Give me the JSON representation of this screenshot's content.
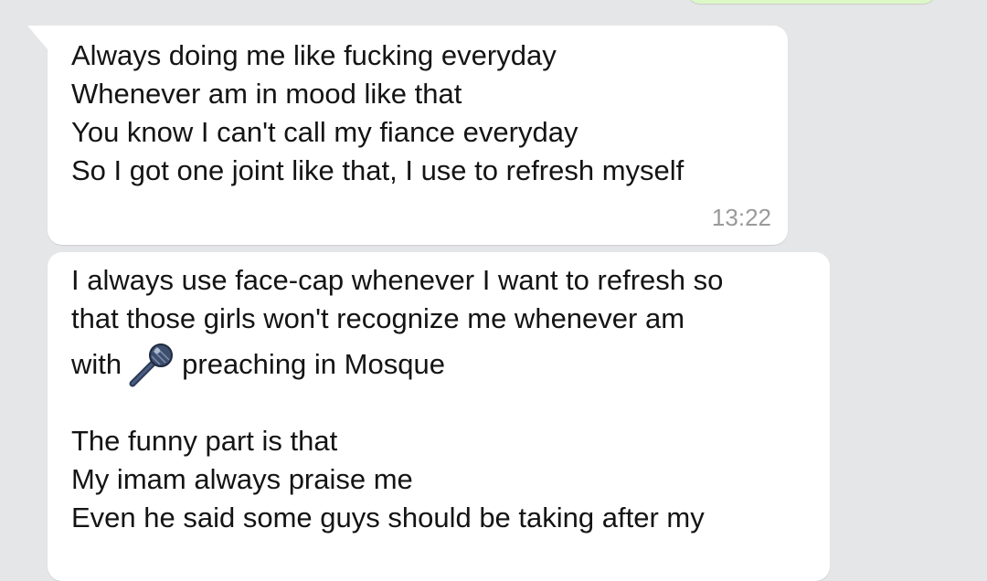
{
  "colors": {
    "background": "#e5e6e8",
    "incoming_bubble": "#ffffff",
    "outgoing_bubble": "#dcf8c6",
    "timestamp": "#9a9a9a",
    "text": "#141414"
  },
  "messages": [
    {
      "direction": "incoming",
      "lines": [
        "Always doing me like fucking everyday",
        "Whenever am in mood like that",
        "You know I can't call my fiance everyday",
        "So I got one joint like that, I use to refresh myself"
      ],
      "time": "13:22"
    },
    {
      "direction": "incoming",
      "line1": "I always use face-cap whenever I want to refresh so",
      "line2": "that those girls won't recognize me  whenever am",
      "line3_before_icon": "with",
      "line3_icon": "microphone-icon",
      "line3_after_icon": "preaching in Mosque",
      "line4": "The funny part is that",
      "line5": "My imam always praise me",
      "line6": "Even he said some guys should be taking after my"
    }
  ]
}
